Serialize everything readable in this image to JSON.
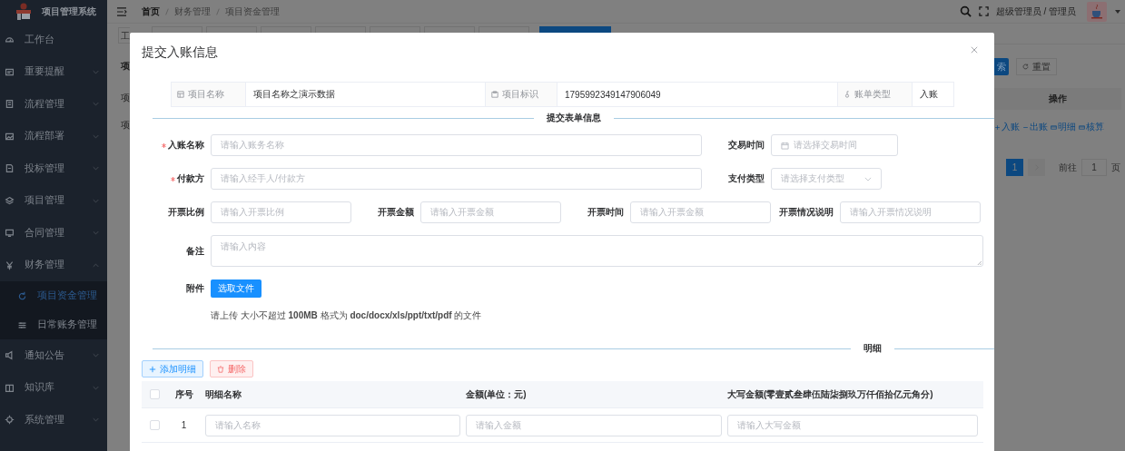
{
  "sidebar": {
    "title": "项目管理系统",
    "items": [
      {
        "label": "工作台",
        "selected": false
      },
      {
        "label": "重要提醒",
        "selected": false,
        "expanded": false
      },
      {
        "label": "流程管理",
        "selected": false,
        "expanded": false
      },
      {
        "label": "流程部署",
        "selected": false,
        "expanded": false
      },
      {
        "label": "投标管理",
        "selected": false,
        "expanded": false
      },
      {
        "label": "项目管理",
        "selected": false,
        "expanded": false
      },
      {
        "label": "合同管理",
        "selected": false,
        "expanded": false
      },
      {
        "label": "财务管理",
        "selected": false,
        "expanded": true,
        "children": [
          {
            "label": "项目资金管理",
            "selected": true
          },
          {
            "label": "日常账务管理",
            "selected": false
          }
        ]
      },
      {
        "label": "通知公告",
        "selected": false,
        "expanded": false
      },
      {
        "label": "知识库",
        "selected": false,
        "expanded": false
      },
      {
        "label": "系统管理",
        "selected": false,
        "expanded": false
      }
    ]
  },
  "header": {
    "breadcrumb": [
      "首页",
      "财务管理",
      "项目资金管理"
    ],
    "user": "超级管理员 / 管理员"
  },
  "background": {
    "tabs": [
      {
        "label": "工",
        "selected": false
      },
      {
        "selected": false
      },
      {
        "selected": false
      },
      {
        "selected": false
      },
      {
        "selected": false
      },
      {
        "selected": false
      },
      {
        "selected": false
      },
      {
        "selected": false
      },
      {
        "selected": true
      }
    ],
    "fragments": [
      "项",
      "项",
      "项"
    ],
    "search_button": "索",
    "reset_button": "重置",
    "table_header": "操作",
    "row_actions": [
      "入账",
      "出账",
      "明细",
      "核算"
    ],
    "pagination": {
      "pages": [
        {
          "label": "1",
          "selected": true
        }
      ],
      "goto_label": "前往",
      "goto_value": "1",
      "page_unit": "页"
    }
  },
  "modal": {
    "title": "提交入账信息",
    "info": [
      {
        "label": "项目名称",
        "value": "项目名称之演示数据"
      },
      {
        "label": "项目标识",
        "value": "1795992349147906049"
      },
      {
        "label": "账单类型",
        "value": "入账"
      }
    ],
    "form_section": "提交表单信息",
    "rows": [
      [
        {
          "label": "入账名称",
          "required": true,
          "kind": "text",
          "placeholder": "请输入账务名称"
        },
        {
          "label": "交易时间",
          "required": false,
          "kind": "date",
          "placeholder": "请选择交易时间"
        }
      ],
      [
        {
          "label": "付款方",
          "required": true,
          "kind": "text",
          "placeholder": "请输入经手人/付款方"
        },
        {
          "label": "支付类型",
          "required": false,
          "kind": "select",
          "placeholder": "请选择支付类型"
        }
      ],
      [
        {
          "label": "开票比例",
          "required": false,
          "kind": "text",
          "placeholder": "请输入开票比例"
        },
        {
          "label": "开票金额",
          "required": false,
          "kind": "text",
          "placeholder": "请输入开票金额"
        },
        {
          "label": "开票时间",
          "required": false,
          "kind": "text",
          "placeholder": "请输入开票金额"
        },
        {
          "label": "开票情况说明",
          "required": false,
          "kind": "text",
          "placeholder": "请输入开票情况说明"
        }
      ],
      [
        {
          "label": "备注",
          "required": false,
          "kind": "textarea",
          "placeholder": "请输入内容"
        }
      ]
    ],
    "attachment": {
      "label": "附件",
      "button": "选取文件",
      "tip": "请上传 大小不超过 **100MB** 格式为 **doc/docx/xls/ppt/txt/pdf** 的文件"
    },
    "detail_section": "明细",
    "detail_buttons": [
      {
        "label": "添加明细",
        "kind": "add"
      },
      {
        "label": "删除",
        "kind": "delete"
      }
    ],
    "detail_table": {
      "columns": [
        "序号",
        "明细名称",
        "金额(单位：元)",
        "大写金额(零壹贰叁肆伍陆柒捌玖万仟佰拾亿元角分)"
      ],
      "header_checked": false,
      "rows": [
        {
          "checked": false,
          "index": "1",
          "placeholders": [
            "请输入名称",
            "请输入金额",
            "请输入大写金额"
          ]
        }
      ]
    }
  }
}
